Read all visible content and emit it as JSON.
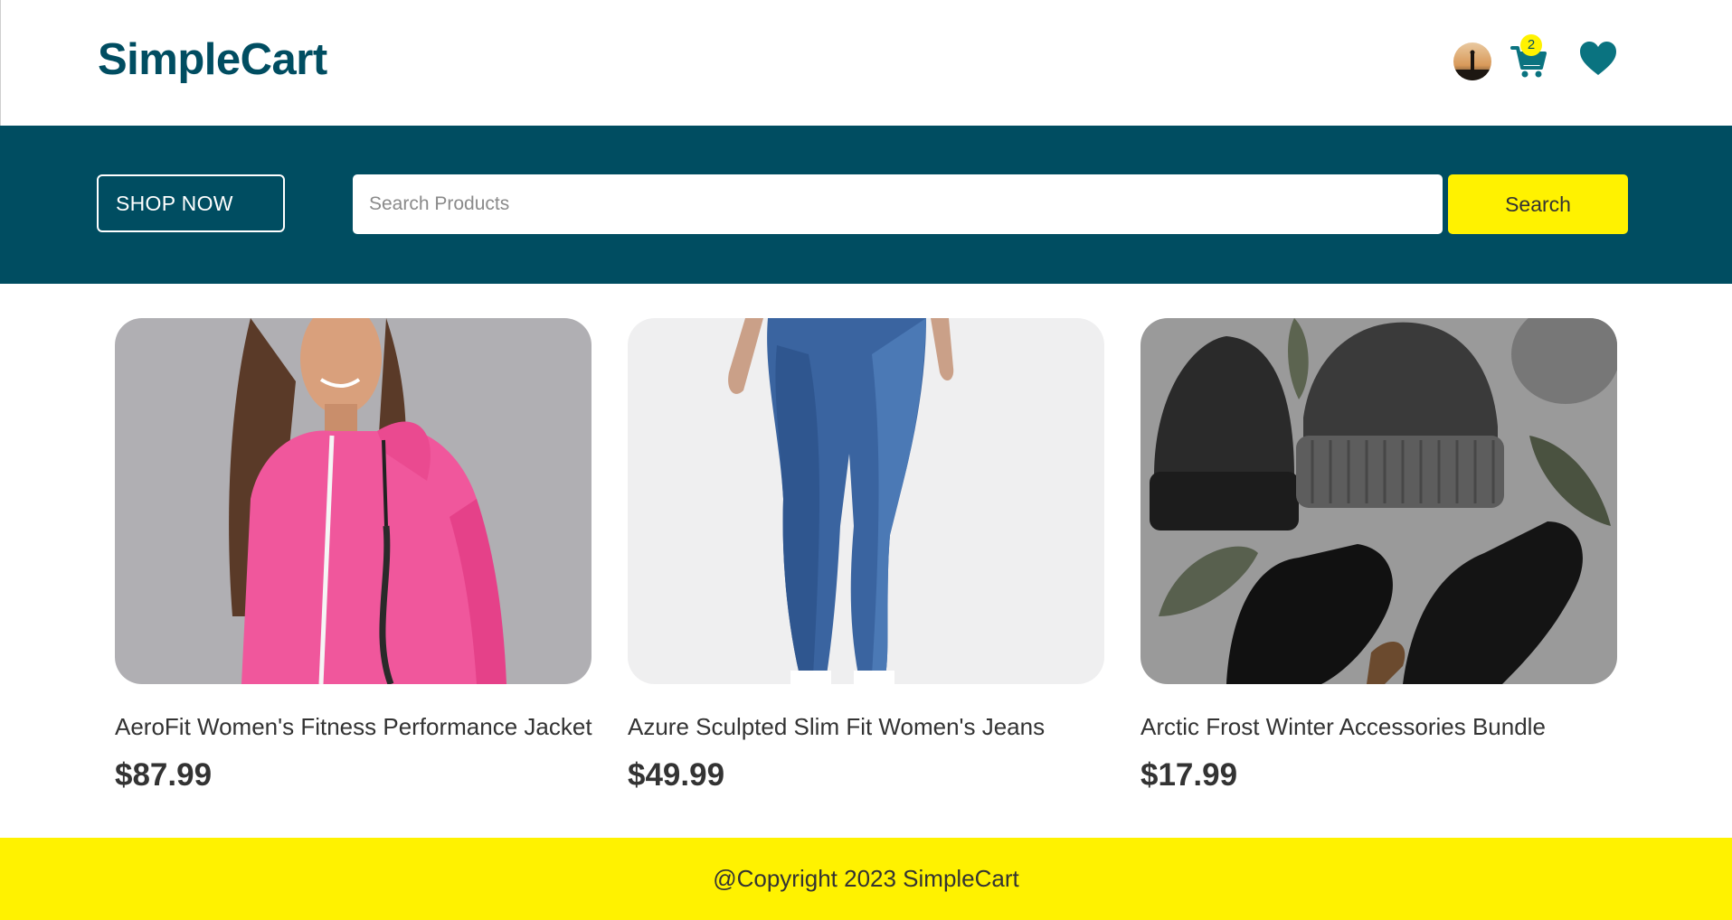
{
  "header": {
    "logo": "SimpleCart",
    "cart_count": "2",
    "icons": [
      "user-avatar",
      "cart-icon",
      "heart-icon"
    ]
  },
  "banner": {
    "shop_now_label": "SHOP NOW",
    "search_placeholder": "Search Products",
    "search_value": "",
    "search_button_label": "Search"
  },
  "products": [
    {
      "title": "AeroFit Women's Fitness Performance Jacket",
      "price": "$87.99",
      "image": "woman-in-pink-hoodie"
    },
    {
      "title": "Azure Sculpted Slim Fit Women's Jeans",
      "price": "$49.99",
      "image": "blue-skinny-jeans"
    },
    {
      "title": "Arctic Frost Winter Accessories Bundle",
      "price": "$17.99",
      "image": "black-beanies-and-gloves"
    }
  ],
  "footer": {
    "copyright": "@Copyright 2023 SimpleCart"
  },
  "colors": {
    "brand": "#004d61",
    "accent": "#fff200",
    "text": "#333333",
    "background": "#ffffff"
  }
}
